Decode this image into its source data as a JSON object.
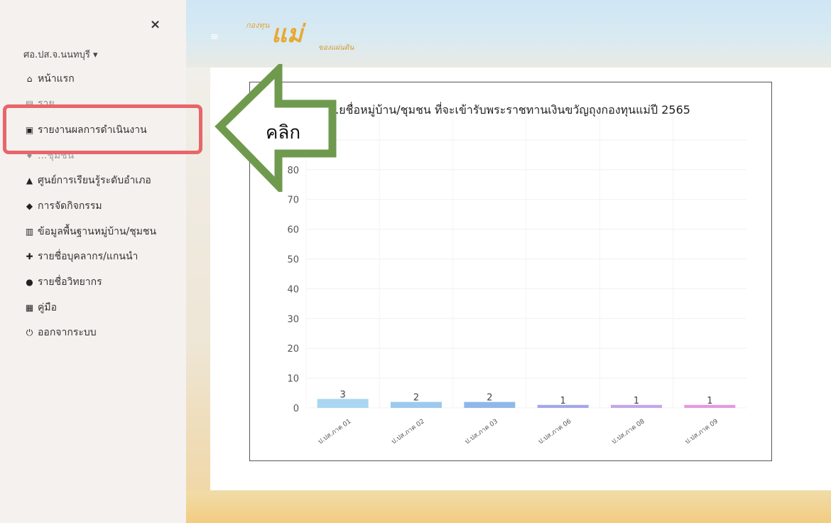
{
  "sidebar": {
    "close_label": "×",
    "user": "ศอ.ปส.จ.นนทบุรี ▾",
    "items": [
      {
        "icon": "home-icon",
        "glyph": "⌂",
        "label": "หน้าแรก"
      },
      {
        "icon": "document-icon",
        "glyph": "▤",
        "label": "ราย..."
      },
      {
        "icon": "report-file-icon",
        "glyph": "▣",
        "label": "รายงานผลการดำเนินงาน"
      },
      {
        "icon": "community-icon",
        "glyph": "♦",
        "label": "...ชุมชน"
      },
      {
        "icon": "learning-center-icon",
        "glyph": "▲",
        "label": "ศูนย์การเรียนรู้ระดับอำเภอ"
      },
      {
        "icon": "activity-icon",
        "glyph": "◆",
        "label": "การจัดกิจกรรม"
      },
      {
        "icon": "building-icon",
        "glyph": "▥",
        "label": "ข้อมูลพื้นฐานหมู่บ้าน/ชุมชน"
      },
      {
        "icon": "add-user-icon",
        "glyph": "✚",
        "label": "รายชื่อบุคลากร/แกนนำ"
      },
      {
        "icon": "microphone-icon",
        "glyph": "●",
        "label": "รายชื่อวิทยากร"
      },
      {
        "icon": "manual-icon",
        "glyph": "▦",
        "label": "คู่มือ"
      },
      {
        "icon": "power-icon",
        "glyph": "⏻",
        "label": "ออกจากระบบ"
      }
    ]
  },
  "header": {
    "menu_icon": "hamburger-icon",
    "menu_glyph": "≡",
    "logo_line1": "กองทุน",
    "logo_line2": "แม่",
    "logo_line3": "ของแผ่นดิน"
  },
  "annotation": {
    "arrow_label": "คลิก",
    "highlight_color": "#e8656b",
    "arrow_color": "#6f9a4e"
  },
  "chart_data": {
    "type": "bar",
    "title": "...ยชื่อหมู่บ้าน/ชุมชน ที่จะเข้ารับพระราชทานเงินขวัญถุงกองทุนแม่ปี 2565",
    "categories": [
      "ป.ปส.ภาค 01",
      "ป.ปส.ภาค 02",
      "ป.ปส.ภาค 03",
      "ป.ปส.ภาค 06",
      "ป.ปส.ภาค 08",
      "ป.ปส.ภาค 09"
    ],
    "values": [
      3,
      2,
      2,
      1,
      1,
      1
    ],
    "colors": [
      "#a9d6f2",
      "#9cc9ee",
      "#8fb8ea",
      "#a4a6ea",
      "#c2a6ec",
      "#e39ae0"
    ],
    "yticks": [
      0,
      10,
      20,
      30,
      40,
      50,
      60,
      70,
      80,
      90
    ],
    "ylim": [
      0,
      100
    ],
    "grid": true
  }
}
